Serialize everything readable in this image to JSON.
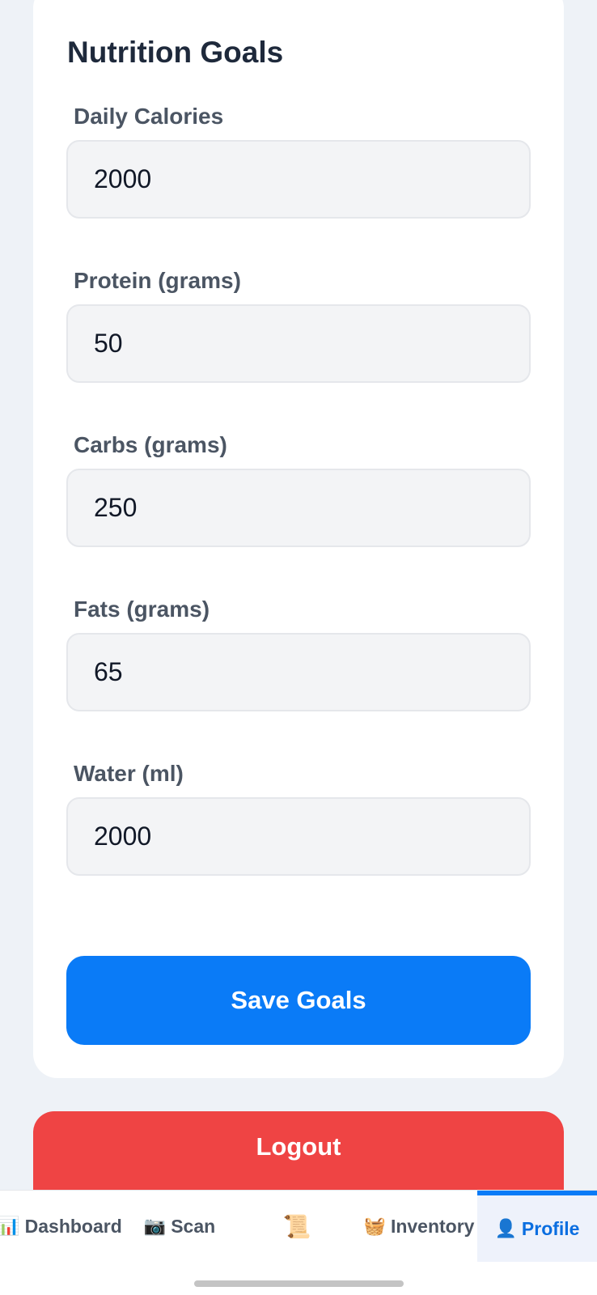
{
  "card": {
    "title": "Nutrition Goals",
    "fields": [
      {
        "label": "Daily Calories",
        "value": "2000"
      },
      {
        "label": "Protein (grams)",
        "value": "50"
      },
      {
        "label": "Carbs (grams)",
        "value": "250"
      },
      {
        "label": "Fats (grams)",
        "value": "65"
      },
      {
        "label": "Water (ml)",
        "value": "2000"
      }
    ],
    "save_label": "Save Goals"
  },
  "logout_label": "Logout",
  "nav": {
    "items": [
      {
        "icon": "📊",
        "icon_name": "chart-icon",
        "label": "Dashboard"
      },
      {
        "icon": "📷",
        "icon_name": "camera-icon",
        "label": "Scan"
      },
      {
        "icon": "📜",
        "icon_name": "scroll-icon",
        "label": ""
      },
      {
        "icon": "🧺",
        "icon_name": "basket-icon",
        "label": "Inventory"
      },
      {
        "icon": "👤",
        "icon_name": "user-icon",
        "label": "Profile"
      }
    ],
    "active_index": 4
  },
  "colors": {
    "primary": "#0a7bf7",
    "danger": "#ef4444",
    "background": "#eef2f7"
  }
}
